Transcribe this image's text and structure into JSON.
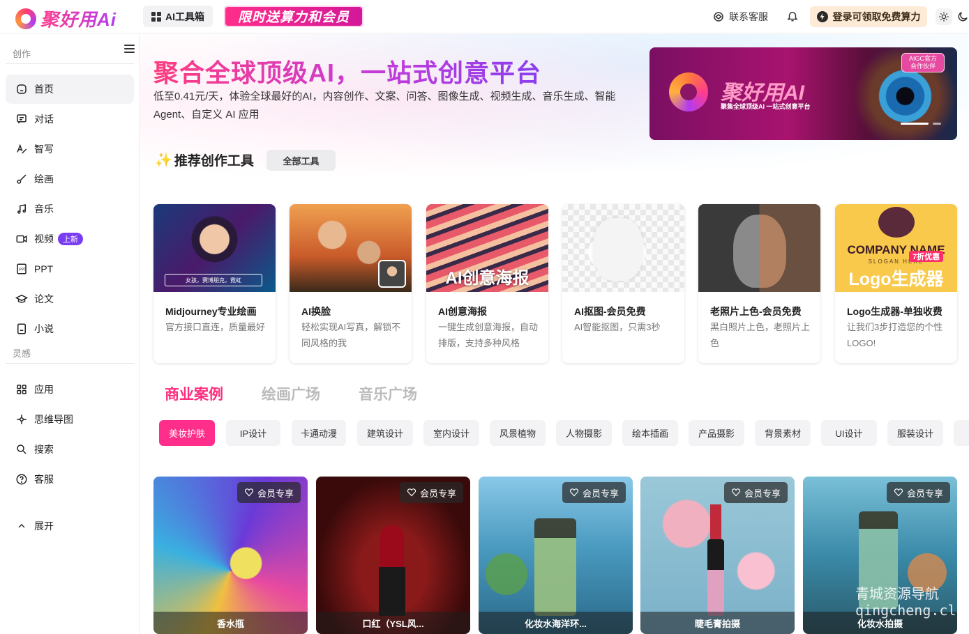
{
  "header": {
    "logo_text": "聚好用Ai",
    "toolbox_label": "AI工具箱",
    "promo_label": "限时送算力和会员",
    "contact_label": "联系客服",
    "login_label": "登录可领取免费算力"
  },
  "sidebar": {
    "section_create": "创作",
    "items_create": [
      {
        "label": "首页",
        "icon": "home-icon"
      },
      {
        "label": "对话",
        "icon": "chat-icon"
      },
      {
        "label": "智写",
        "icon": "write-icon"
      },
      {
        "label": "绘画",
        "icon": "brush-icon"
      },
      {
        "label": "音乐",
        "icon": "music-icon"
      },
      {
        "label": "视频",
        "icon": "video-icon",
        "badge": "上新"
      },
      {
        "label": "PPT",
        "icon": "ppt-icon"
      },
      {
        "label": "论文",
        "icon": "graduation-cap-icon"
      },
      {
        "label": "小说",
        "icon": "book-icon"
      }
    ],
    "section_inspire": "灵感",
    "items_inspire": [
      {
        "label": "应用",
        "icon": "apps-grid-icon"
      },
      {
        "label": "思维导图",
        "icon": "mindmap-icon"
      },
      {
        "label": "搜索",
        "icon": "search-icon"
      },
      {
        "label": "客服",
        "icon": "help-icon"
      }
    ],
    "expand_label": "展开"
  },
  "hero": {
    "title": "聚合全球顶级AI，一站式创意平台",
    "desc": "低至0.41元/天，体验全球最好的AI，内容创作、文案、问答、图像生成、视频生成、音乐生成、智能 Agent、自定义 AI 应用"
  },
  "banner": {
    "brand": "聚好用AI",
    "slogan": "聚集全球顶级AI 一站式创意平台",
    "tag_line1": "AIGC官方",
    "tag_line2": "合作伙伴"
  },
  "tools": {
    "title": "推荐创作工具",
    "all_label": "全部工具",
    "items": [
      {
        "name": "Midjourney专业绘画",
        "desc": "官方接口直连，质量最好",
        "img_text": "女孩，赛博朋克，霓虹"
      },
      {
        "name": "AI换脸",
        "desc": "轻松实现AI写真，解锁不同风格的我",
        "img_text": ""
      },
      {
        "name": "AI创意海报",
        "desc": "一键生成创意海报，自动排版，支持多种风格",
        "img_text": "AI创意海报"
      },
      {
        "name": "AI抠图-会员免费",
        "desc": "AI智能抠图，只需3秒",
        "img_text": ""
      },
      {
        "name": "老照片上色-会员免费",
        "desc": "黑白照片上色，老照片上色",
        "img_text": ""
      },
      {
        "name": "Logo生成器-单独收费",
        "desc": "让我们3步打造您的个性LOGO!",
        "img_text": "Logo生成器",
        "img_sub": "COMPANY NAME",
        "img_slogan": "SLOGAN HERE",
        "img_discount": "7折优惠"
      }
    ]
  },
  "tabs": {
    "items": [
      "商业案例",
      "绘画广场",
      "音乐广场"
    ],
    "active": 0
  },
  "chips": {
    "items": [
      "美妆护肤",
      "IP设计",
      "卡通动漫",
      "建筑设计",
      "室内设计",
      "风景植物",
      "人物摄影",
      "绘本插画",
      "产品摄影",
      "背景素材",
      "UI设计",
      "服装设计"
    ],
    "active": 0
  },
  "cases": {
    "vip_label": "会员专享",
    "items": [
      {
        "caption": "香水瓶"
      },
      {
        "caption": "口红（YSL风..."
      },
      {
        "caption": "化妆水海洋环..."
      },
      {
        "caption": "睫毛膏拍摄"
      },
      {
        "caption": "化妆水拍摄"
      }
    ]
  },
  "watermark": {
    "line1": "青城资源导航",
    "line2": "qingcheng.club"
  },
  "colors": {
    "brand_pink": "#ff2e8a",
    "brand_purple": "#8a3ef0",
    "new_badge": "#7a3cf0",
    "login_bg": "#fdebd7"
  }
}
